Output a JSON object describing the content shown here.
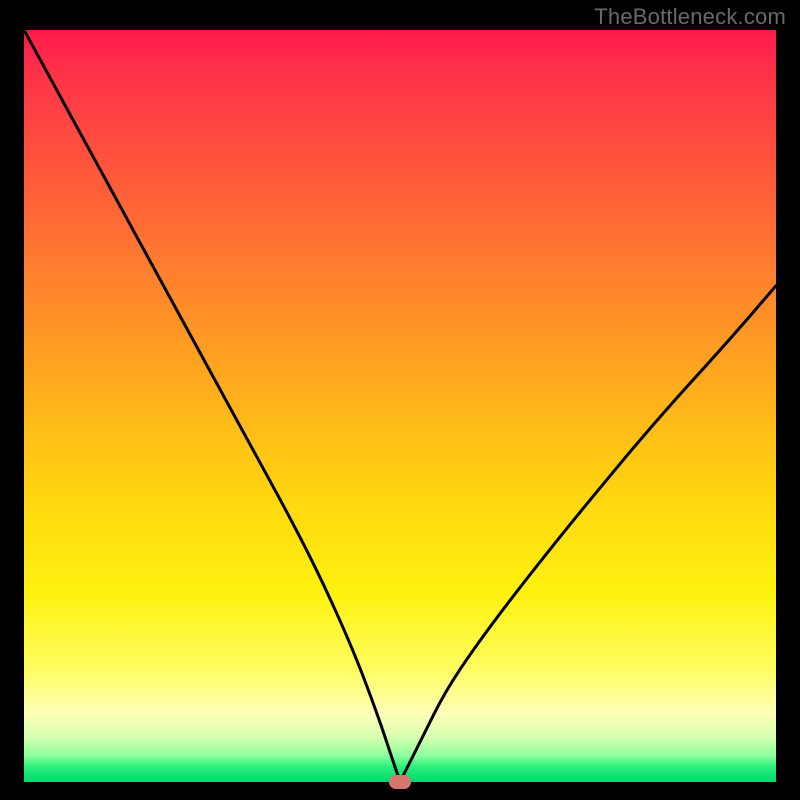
{
  "watermark": "TheBottleneck.com",
  "chart_data": {
    "type": "line",
    "title": "",
    "xlabel": "",
    "ylabel": "",
    "xlim": [
      0,
      100
    ],
    "ylim": [
      0,
      100
    ],
    "grid": false,
    "legend": false,
    "background_gradient": {
      "stops": [
        {
          "pos": 0,
          "color": "#ff1a4d"
        },
        {
          "pos": 50,
          "color": "#ffd90f"
        },
        {
          "pos": 85,
          "color": "#fffd60"
        },
        {
          "pos": 100,
          "color": "#00d86a"
        }
      ]
    },
    "series": [
      {
        "name": "bottleneck-curve",
        "color": "#000000",
        "x": [
          0,
          6,
          12,
          18,
          24,
          30,
          36,
          40,
          44,
          47,
          49,
          50,
          51,
          53,
          56,
          60,
          66,
          74,
          84,
          94,
          100
        ],
        "y": [
          100,
          89,
          78,
          67,
          56,
          45,
          34,
          26,
          17,
          9,
          3,
          0,
          2,
          6,
          12,
          18,
          26,
          36,
          48,
          59,
          66
        ]
      }
    ],
    "marker": {
      "x": 50,
      "y": 0,
      "color": "#d6766f"
    }
  }
}
